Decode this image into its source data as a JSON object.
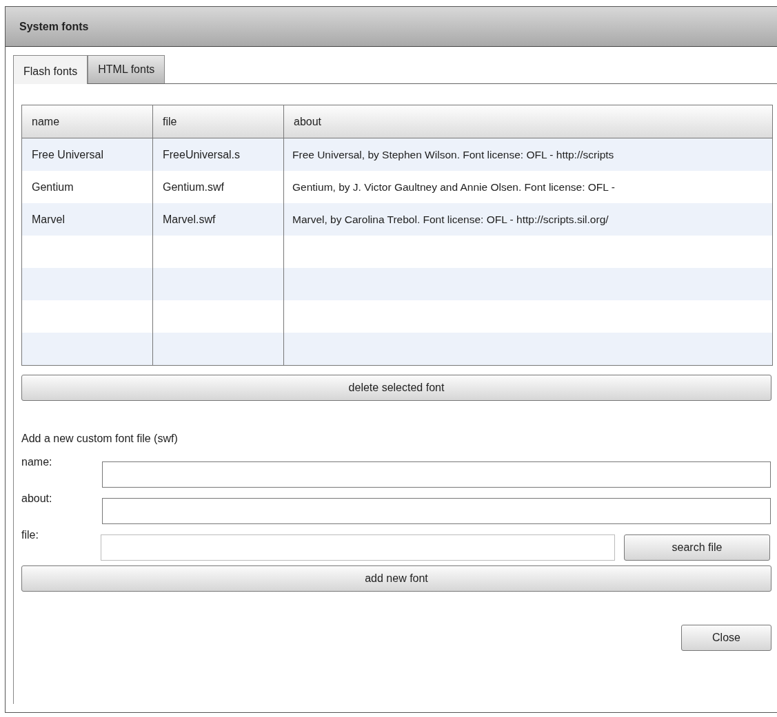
{
  "window": {
    "title": "System fonts"
  },
  "tabs": [
    {
      "label": "Flash fonts",
      "selected": true
    },
    {
      "label": "HTML fonts",
      "selected": false
    }
  ],
  "table": {
    "columns": [
      "name",
      "file",
      "about"
    ],
    "rows": [
      [
        "Free Universal",
        "FreeUniversal.s",
        "Free Universal, by Stephen Wilson. Font license: OFL - http://scripts"
      ],
      [
        "Gentium",
        "Gentium.swf",
        "Gentium, by J. Victor Gaultney and Annie Olsen. Font license: OFL -"
      ],
      [
        "Marvel",
        "Marvel.swf",
        "Marvel, by Carolina Trebol. Font license: OFL - http://scripts.sil.org/"
      ]
    ]
  },
  "delete_button": "delete selected font",
  "add_section": {
    "heading": "Add a new custom font file (swf)",
    "fields": [
      {
        "label": "name:",
        "kind": "text"
      },
      {
        "label": "about:",
        "kind": "text"
      },
      {
        "label": "file:",
        "kind": "file",
        "button": "search file"
      }
    ],
    "add_button": "add new font"
  },
  "close_button": "Close"
}
